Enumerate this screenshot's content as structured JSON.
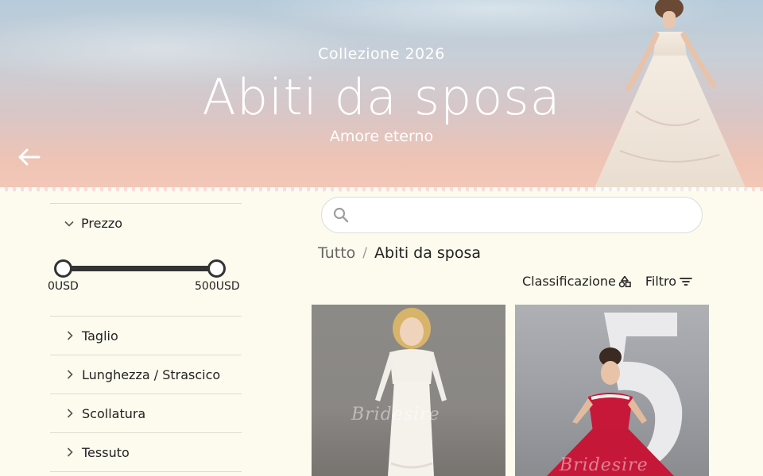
{
  "hero": {
    "subtitle": "Collezione 2026",
    "title": "Abiti da sposa",
    "tagline": "Amore eterno",
    "back_icon": "arrow-left-icon"
  },
  "sidebar": {
    "price": {
      "label": "Prezzo",
      "expanded": true,
      "min_label": "0USD",
      "max_label": "500USD",
      "range_min": 0,
      "range_max": 500,
      "selected_min": 0,
      "selected_max": 500
    },
    "filters": [
      {
        "label": "Taglio"
      },
      {
        "label": "Lunghezza / Strascico"
      },
      {
        "label": "Scollatura"
      },
      {
        "label": "Tessuto"
      }
    ]
  },
  "search": {
    "placeholder": "",
    "value": "",
    "icon": "search-icon"
  },
  "breadcrumb": {
    "root": "Tutto",
    "separator": "/",
    "current": "Abiti da sposa"
  },
  "toolbar": {
    "sort_label": "Classificazione",
    "sort_icon": "shapes-icon",
    "filter_label": "Filtro",
    "filter_icon": "filter-lines-icon"
  },
  "products": [
    {
      "watermark": "Bridesire"
    },
    {
      "watermark": "Bridesire"
    }
  ],
  "colors": {
    "page_background": "#fcfbee",
    "text": "#222222",
    "slider": "#333333"
  }
}
